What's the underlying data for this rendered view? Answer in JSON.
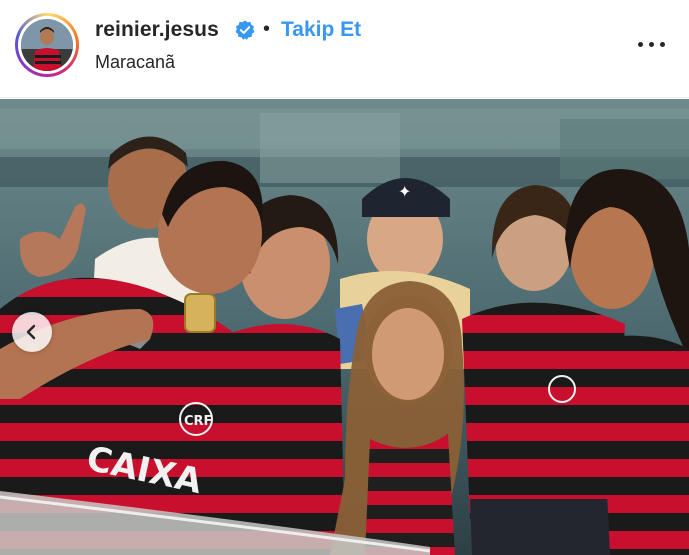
{
  "post": {
    "username": "reinier.jesus",
    "separator": "•",
    "follow_label": "Takip Et",
    "location": "Maracanã",
    "verified": true
  },
  "icons": {
    "verified": "verified-badge-icon",
    "more": "more-options-icon",
    "prev": "chevron-left-icon"
  },
  "colors": {
    "accent": "#3897f0",
    "text": "#262626",
    "jersey_red": "#c8102e",
    "jersey_black": "#1a1a1a"
  },
  "photo": {
    "jersey_text_sponsor": "CAIXA",
    "crest_text": "CRF"
  }
}
